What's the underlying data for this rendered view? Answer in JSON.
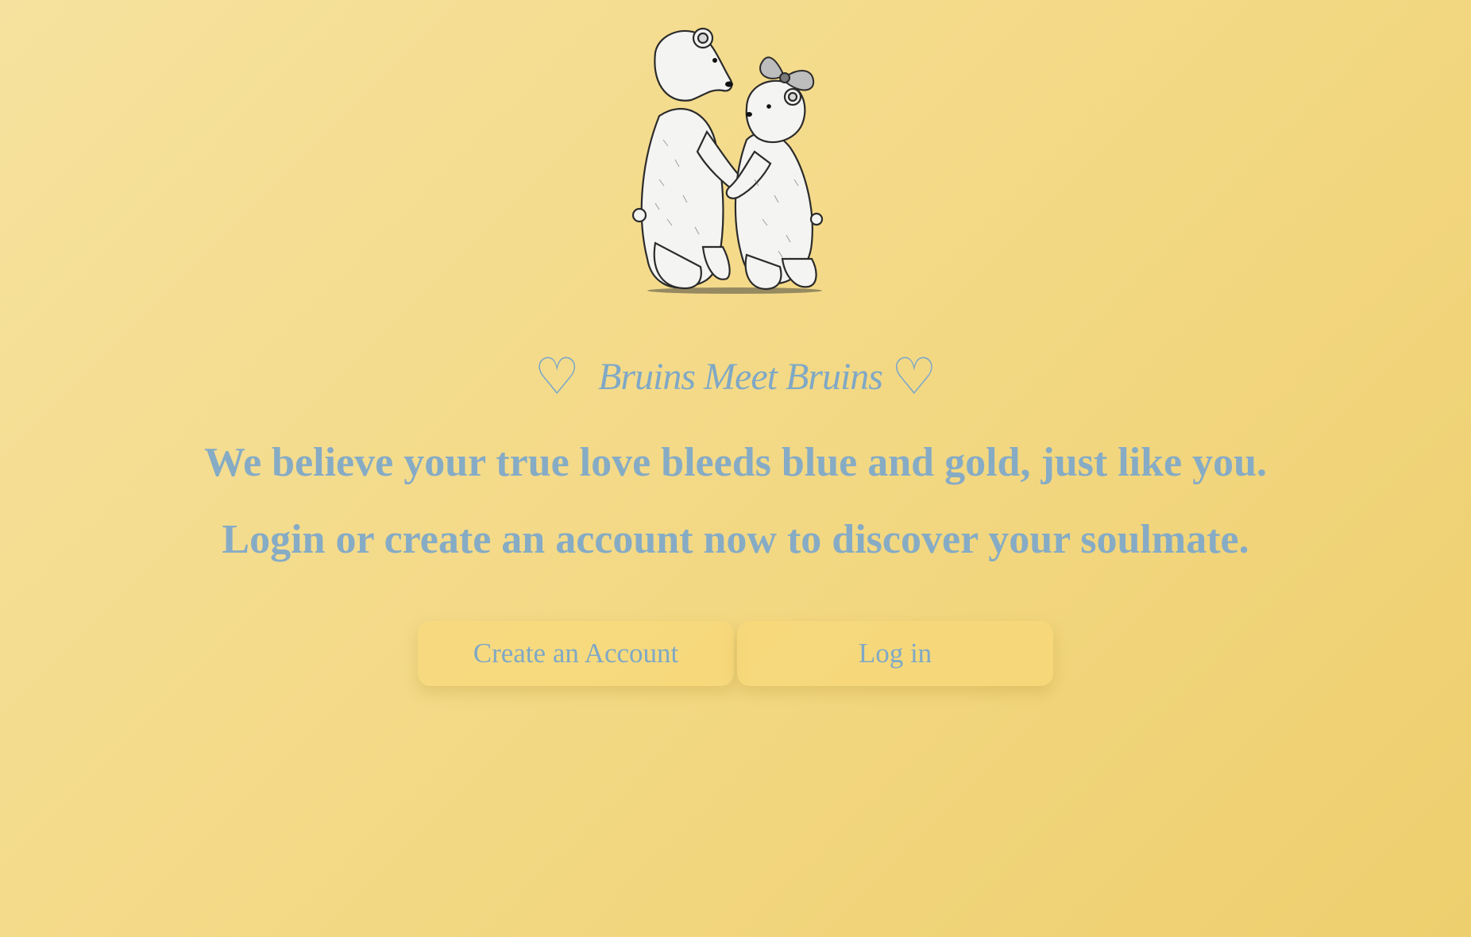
{
  "hero": {
    "heart_left": "♡",
    "brand_name": "Bruins Meet Bruins",
    "heart_right": "♡",
    "tagline_1": "We believe your true love bleeds blue and gold, just like you.",
    "tagline_2": "Login or create an account now to discover your soulmate."
  },
  "actions": {
    "create_label": "Create an Account",
    "login_label": "Log in"
  },
  "colors": {
    "accent_blue": "#7fa8c6",
    "background_gold": "#f3d883"
  },
  "logo": {
    "icon": "two-bears-hugging-icon"
  }
}
